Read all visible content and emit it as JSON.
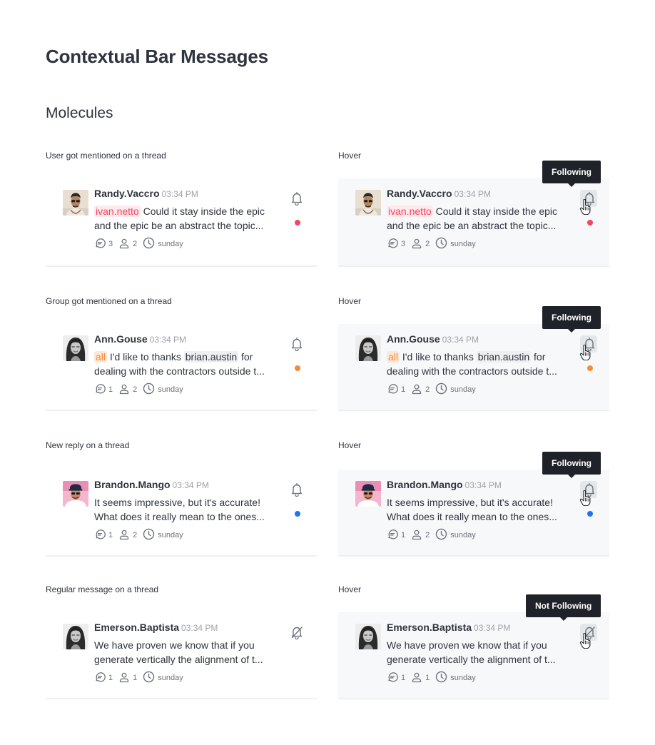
{
  "page": {
    "title": "Contextual Bar Messages",
    "section": "Molecules"
  },
  "colors": {
    "red": "#f5455c",
    "orange": "#f38c39",
    "blue": "#1d74f5",
    "text": "#2f343d",
    "muted": "#9ea2a8"
  },
  "rows": [
    {
      "label": "User got mentioned on a thread",
      "hover_label": "Hover",
      "tooltip": "Following",
      "user": "Randy.Vaccro",
      "time": "03:34 PM",
      "mention": "ivan.netto",
      "line1": "Could it stay inside the epic",
      "line2": "and the epic be an abstract the topic...",
      "replies": "3",
      "participants": "2",
      "last": "sunday",
      "dot": "red",
      "avatar": "man-sunglasses"
    },
    {
      "label": "Group got mentioned on a thread",
      "hover_label": "Hover",
      "tooltip": "Following",
      "user": "Ann.Gouse",
      "time": "03:34 PM",
      "mention": "all",
      "line1": "I'd like to thanks",
      "user_mention": "brian.austin",
      "line1_end": "for",
      "line2": "dealing with the contractors outside t...",
      "replies": "1",
      "participants": "2",
      "last": "sunday",
      "dot": "orange",
      "avatar": "woman-bw"
    },
    {
      "label": "New reply on a thread",
      "hover_label": "Hover",
      "tooltip": "Following",
      "user": "Brandon.Mango",
      "time": "03:34 PM",
      "line1": "It seems impressive, but it's accurate!",
      "line2": "What does it really mean to the ones...",
      "replies": "1",
      "participants": "2",
      "last": "sunday",
      "dot": "blue",
      "avatar": "man-pink"
    },
    {
      "label": "Regular message on a thread",
      "hover_label": "Hover",
      "tooltip": "Not Following",
      "user": "Emerson.Baptista",
      "time": "03:34 PM",
      "line1": "We have proven we know that if you",
      "line2": "generate vertically the alignment of t...",
      "replies": "1",
      "participants": "1",
      "last": "sunday",
      "avatar": "woman-bw"
    }
  ]
}
